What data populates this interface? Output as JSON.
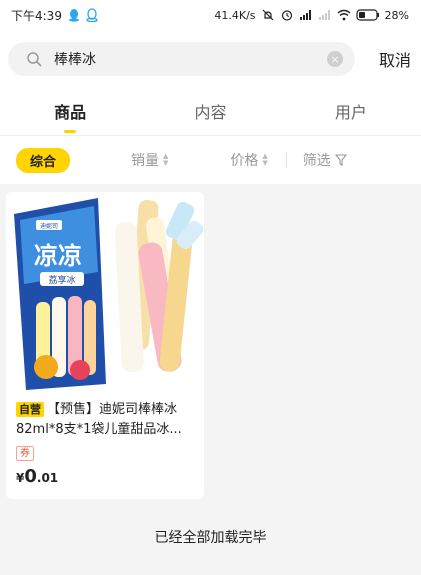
{
  "status_bar": {
    "time": "下午4:39",
    "network_speed": "41.4K/s",
    "battery_percent": "28%"
  },
  "search": {
    "query": "棒棒冰",
    "cancel_label": "取消"
  },
  "tabs": [
    {
      "label": "商品",
      "active": true
    },
    {
      "label": "内容",
      "active": false
    },
    {
      "label": "用户",
      "active": false
    }
  ],
  "filters": {
    "comprehensive": "综合",
    "sales": "销量",
    "price": "价格",
    "screen": "筛选"
  },
  "products": [
    {
      "self_operated_tag": "自营",
      "title": "【预售】迪妮司棒棒冰82ml*8支*1袋儿童甜品冰...",
      "coupon_label": "券",
      "price_currency": "¥",
      "price_integer": "0",
      "price_decimal": ".01",
      "image_text": {
        "brand": "迪妮司",
        "title": "凉凉",
        "subtitle": "荔享冰"
      }
    }
  ],
  "footer": {
    "end_message": "已经全部加载完毕"
  },
  "colors": {
    "accent_yellow": "#ffd400",
    "coupon_red": "#e0583c"
  }
}
